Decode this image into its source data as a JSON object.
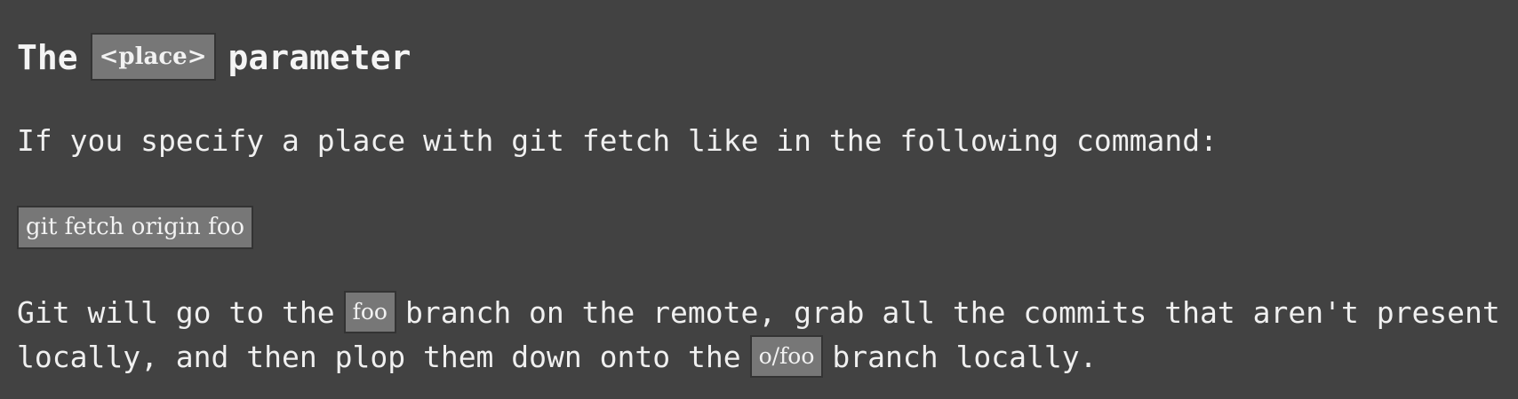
{
  "section": {
    "heading_before": "The",
    "heading_code": "<place>",
    "heading_after": "parameter"
  },
  "intro_text": "If you specify a place with git fetch like in the following command:",
  "command": "git fetch origin foo",
  "explanation": {
    "line1_before": "Git will go to the",
    "line1_code": "foo",
    "line1_after": "branch on the remote, grab all the commits that aren't present",
    "line2_before": "locally, and then plop them down onto the",
    "line2_code": "o/foo",
    "line2_after": "branch locally."
  }
}
